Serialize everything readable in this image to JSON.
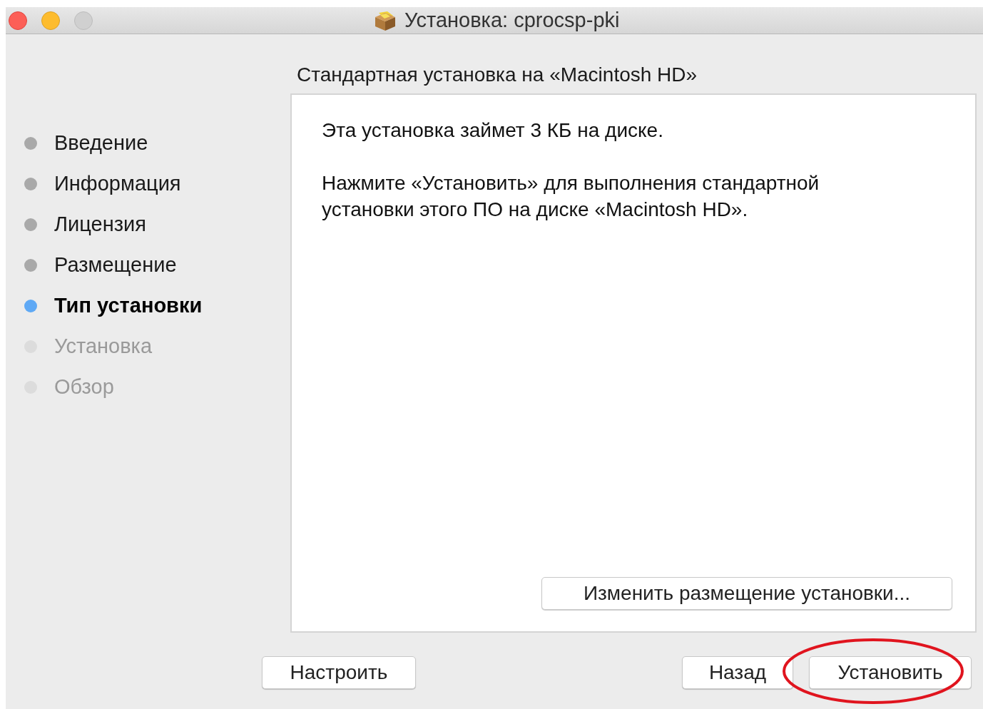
{
  "window": {
    "title": "Установка: cprocsp-pki"
  },
  "sidebar": {
    "steps": [
      {
        "label": "Введение",
        "kind": "done"
      },
      {
        "label": "Информация",
        "kind": "done"
      },
      {
        "label": "Лицензия",
        "kind": "done"
      },
      {
        "label": "Размещение",
        "kind": "done"
      },
      {
        "label": "Тип установки",
        "kind": "current"
      },
      {
        "label": "Установка",
        "kind": "pending"
      },
      {
        "label": "Обзор",
        "kind": "pending"
      }
    ]
  },
  "heading": "Стандартная установка на «Macintosh HD»",
  "panel": {
    "paragraphs": [
      "Эта установка займет 3 КБ на диске.",
      "Нажмите «Установить» для выполнения стандартной установки этого ПО на диске «Macintosh HD»."
    ],
    "location_button": "Изменить размещение установки..."
  },
  "buttons": {
    "customize": "Настроить",
    "back": "Назад",
    "install": {
      "label": "Установить",
      "circled": true
    }
  }
}
